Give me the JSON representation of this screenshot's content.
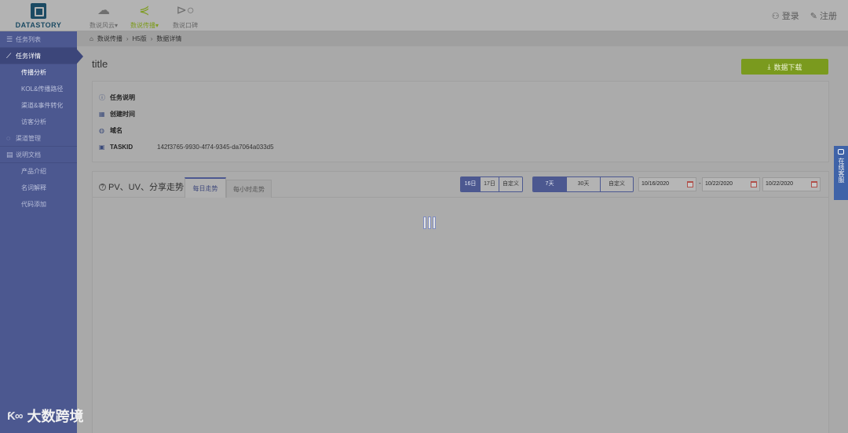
{
  "header": {
    "logo_text": "DATASTORY",
    "nav": [
      {
        "label": "数说风云",
        "icon": "cloud-icon",
        "active": false
      },
      {
        "label": "数说传播",
        "icon": "share-icon",
        "active": true
      },
      {
        "label": "数说口碑",
        "icon": "megaphone-icon",
        "active": false
      }
    ],
    "login": "登录",
    "register": "注册"
  },
  "sidebar": {
    "groups": [
      {
        "label": "任务列表",
        "icon": "list-icon"
      },
      {
        "label": "任务详情",
        "icon": "chart-icon",
        "active": true
      },
      {
        "label": "渠道管理",
        "icon": "globe-icon"
      },
      {
        "label": "说明文档",
        "icon": "document-icon"
      }
    ],
    "detail_items": [
      {
        "label": "传播分析",
        "active": true
      },
      {
        "label": "KOL&传播路径"
      },
      {
        "label": "渠道&事件转化"
      },
      {
        "label": "访客分析"
      }
    ],
    "doc_items": [
      {
        "label": "产品介绍"
      },
      {
        "label": "名词解释"
      },
      {
        "label": "代码添加"
      }
    ]
  },
  "breadcrumb": {
    "items": [
      "数说传播",
      "H5版",
      "数据详情"
    ]
  },
  "main": {
    "title": "title",
    "download_label": "数据下载",
    "info": [
      {
        "label": "任务说明",
        "value": ""
      },
      {
        "label": "创建时间",
        "value": ""
      },
      {
        "label": "域名",
        "value": ""
      },
      {
        "label": "TASKID",
        "value": "142f3765-9930-4f74-9345-da7064a033d5"
      }
    ],
    "chart": {
      "title": "PV、UV、分享走势",
      "tabs": [
        "每日走势",
        "每小时走势"
      ],
      "day_buttons": [
        "16日",
        "17日",
        "自定义"
      ],
      "range_buttons": [
        "7天",
        "30天",
        "自定义"
      ],
      "date_from": "10/16/2020",
      "date_to": "10/22/2020",
      "date_single": "10/22/2020",
      "date_sep": "-"
    }
  },
  "service": {
    "label": "在线客服"
  },
  "watermark": {
    "mark": "Ƙ∞",
    "text": "大数跨境"
  },
  "colors": {
    "sidebar": "#4c5890",
    "accent_green": "#7a9a1e",
    "service_blue": "#3f63a8"
  }
}
